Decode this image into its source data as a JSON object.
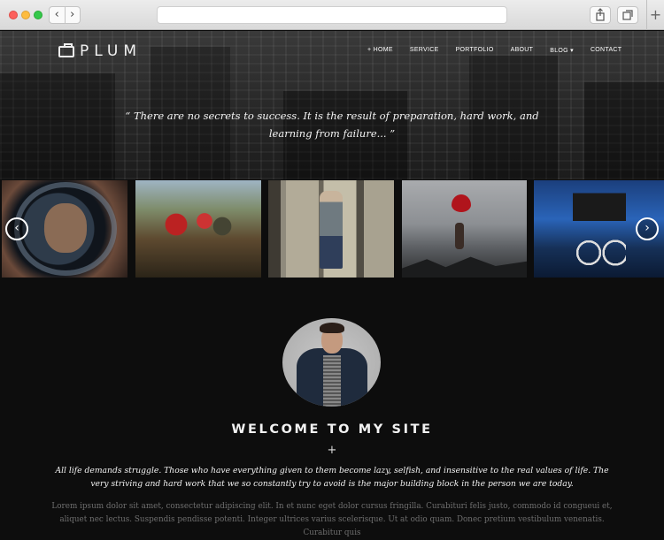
{
  "browser": {
    "back_glyph": "‹",
    "forward_glyph": "›",
    "new_tab_glyph": "+"
  },
  "site": {
    "logo_text": "PLUM",
    "logo_icon": "briefcase-icon",
    "menu": [
      "+ HOME",
      "SERVICE",
      "PORTFOLIO",
      "ABOUT",
      "BLOG ▾",
      "CONTACT"
    ]
  },
  "hero": {
    "quote_open": "“",
    "quote_text": "There are no secrets to success. It is the result of preparation, hard work, and learning from failure...",
    "quote_close": "”"
  },
  "gallery": {
    "prev_glyph": "‹",
    "next_glyph": "›"
  },
  "about": {
    "heading": "WELCOME TO MY SITE",
    "divider": "+",
    "intro": "All life demands struggle. Those who have everything given to them become lazy, selfish, and insensitive to the real values of life. The very striving and hard work that we so constantly try to avoid is the major building block in the person we are today.",
    "lorem": "Lorem ipsum dolor sit amet, consectetur adipiscing elit. In et nunc eget dolor cursus fringilla. Curabituri felis justo, commodo id congueui et, aliquet nec lectus. Suspendis pendisse potenti. Integer ultrices varius scelerisque. Ut at odio quam. Donec pretium vestibulum venenatis. Curabitur quis"
  }
}
